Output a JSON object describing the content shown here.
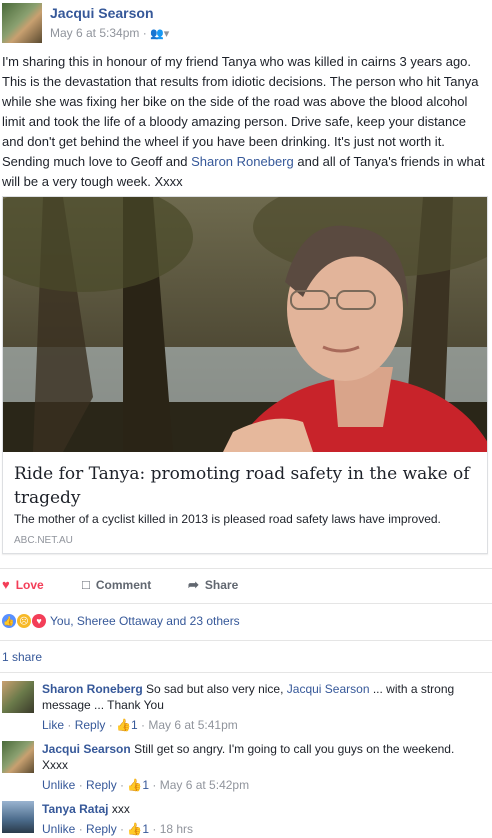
{
  "post": {
    "author": "Jacqui Searson",
    "timestamp": "May 6 at 5:34pm",
    "meta_separator": "·",
    "text_before": "I'm sharing this in honour of my friend Tanya who was killed in cairns 3 years ago. This is the devastation that results from idiotic decisions. The person who hit Tanya while she was fixing her bike on the side of the road was above the blood alcohol limit and took the life of a bloody amazing person. Drive safe, keep your distance and don't get behind the wheel if you have been drinking. It's just not worth it. Sending much love to Geoff and ",
    "mention": "Sharon Roneberg",
    "text_after": " and all of Tanya's friends in what will be a very tough week. Xxxx"
  },
  "link_card": {
    "title": "Ride for Tanya: promoting road safety in the wake of tragedy",
    "description": "The mother of a cyclist killed in 2013 is pleased road safety laws have improved.",
    "source": "ABC.NET.AU"
  },
  "actions": {
    "love": "Love",
    "comment": "Comment",
    "share": "Share",
    "love_color": "#f33e58"
  },
  "reactions": {
    "summary": "You, Sheree Ottaway and 23 others"
  },
  "shares": {
    "count_label": "1 share"
  },
  "comments": [
    {
      "author": "Sharon Roneberg",
      "text_before": "So sad but also very nice, ",
      "mention": "Jacqui Searson",
      "text_after": " ... with a strong message ... Thank You",
      "action1": "Like",
      "action2": "Reply",
      "likes": "1",
      "time": "May 6 at 5:41pm"
    },
    {
      "author": "Jacqui Searson",
      "text": "Still get so angry. I'm going to call you guys on the weekend. Xxxx",
      "action1": "Unlike",
      "action2": "Reply",
      "likes": "1",
      "time": "May 6 at 5:42pm"
    },
    {
      "author": "Tanya Rataj",
      "text": "xxx",
      "action1": "Unlike",
      "action2": "Reply",
      "likes": "1",
      "time": "18 hrs"
    }
  ]
}
